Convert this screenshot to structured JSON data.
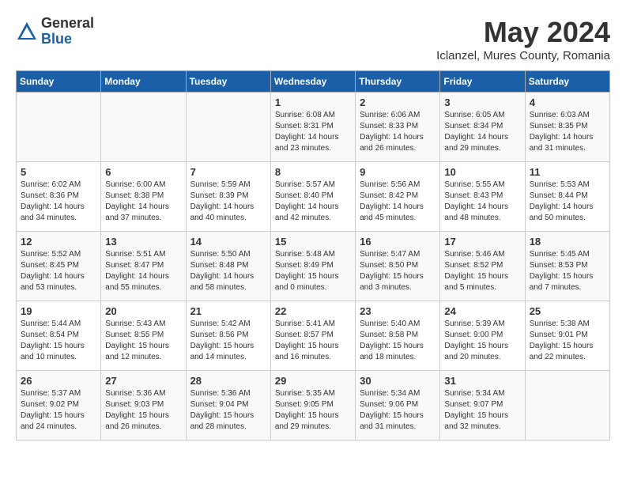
{
  "logo": {
    "general": "General",
    "blue": "Blue"
  },
  "title": {
    "month_year": "May 2024",
    "location": "Iclanzel, Mures County, Romania"
  },
  "headers": [
    "Sunday",
    "Monday",
    "Tuesday",
    "Wednesday",
    "Thursday",
    "Friday",
    "Saturday"
  ],
  "weeks": [
    [
      {
        "day": "",
        "info": ""
      },
      {
        "day": "",
        "info": ""
      },
      {
        "day": "",
        "info": ""
      },
      {
        "day": "1",
        "info": "Sunrise: 6:08 AM\nSunset: 8:31 PM\nDaylight: 14 hours\nand 23 minutes."
      },
      {
        "day": "2",
        "info": "Sunrise: 6:06 AM\nSunset: 8:33 PM\nDaylight: 14 hours\nand 26 minutes."
      },
      {
        "day": "3",
        "info": "Sunrise: 6:05 AM\nSunset: 8:34 PM\nDaylight: 14 hours\nand 29 minutes."
      },
      {
        "day": "4",
        "info": "Sunrise: 6:03 AM\nSunset: 8:35 PM\nDaylight: 14 hours\nand 31 minutes."
      }
    ],
    [
      {
        "day": "5",
        "info": "Sunrise: 6:02 AM\nSunset: 8:36 PM\nDaylight: 14 hours\nand 34 minutes."
      },
      {
        "day": "6",
        "info": "Sunrise: 6:00 AM\nSunset: 8:38 PM\nDaylight: 14 hours\nand 37 minutes."
      },
      {
        "day": "7",
        "info": "Sunrise: 5:59 AM\nSunset: 8:39 PM\nDaylight: 14 hours\nand 40 minutes."
      },
      {
        "day": "8",
        "info": "Sunrise: 5:57 AM\nSunset: 8:40 PM\nDaylight: 14 hours\nand 42 minutes."
      },
      {
        "day": "9",
        "info": "Sunrise: 5:56 AM\nSunset: 8:42 PM\nDaylight: 14 hours\nand 45 minutes."
      },
      {
        "day": "10",
        "info": "Sunrise: 5:55 AM\nSunset: 8:43 PM\nDaylight: 14 hours\nand 48 minutes."
      },
      {
        "day": "11",
        "info": "Sunrise: 5:53 AM\nSunset: 8:44 PM\nDaylight: 14 hours\nand 50 minutes."
      }
    ],
    [
      {
        "day": "12",
        "info": "Sunrise: 5:52 AM\nSunset: 8:45 PM\nDaylight: 14 hours\nand 53 minutes."
      },
      {
        "day": "13",
        "info": "Sunrise: 5:51 AM\nSunset: 8:47 PM\nDaylight: 14 hours\nand 55 minutes."
      },
      {
        "day": "14",
        "info": "Sunrise: 5:50 AM\nSunset: 8:48 PM\nDaylight: 14 hours\nand 58 minutes."
      },
      {
        "day": "15",
        "info": "Sunrise: 5:48 AM\nSunset: 8:49 PM\nDaylight: 15 hours\nand 0 minutes."
      },
      {
        "day": "16",
        "info": "Sunrise: 5:47 AM\nSunset: 8:50 PM\nDaylight: 15 hours\nand 3 minutes."
      },
      {
        "day": "17",
        "info": "Sunrise: 5:46 AM\nSunset: 8:52 PM\nDaylight: 15 hours\nand 5 minutes."
      },
      {
        "day": "18",
        "info": "Sunrise: 5:45 AM\nSunset: 8:53 PM\nDaylight: 15 hours\nand 7 minutes."
      }
    ],
    [
      {
        "day": "19",
        "info": "Sunrise: 5:44 AM\nSunset: 8:54 PM\nDaylight: 15 hours\nand 10 minutes."
      },
      {
        "day": "20",
        "info": "Sunrise: 5:43 AM\nSunset: 8:55 PM\nDaylight: 15 hours\nand 12 minutes."
      },
      {
        "day": "21",
        "info": "Sunrise: 5:42 AM\nSunset: 8:56 PM\nDaylight: 15 hours\nand 14 minutes."
      },
      {
        "day": "22",
        "info": "Sunrise: 5:41 AM\nSunset: 8:57 PM\nDaylight: 15 hours\nand 16 minutes."
      },
      {
        "day": "23",
        "info": "Sunrise: 5:40 AM\nSunset: 8:58 PM\nDaylight: 15 hours\nand 18 minutes."
      },
      {
        "day": "24",
        "info": "Sunrise: 5:39 AM\nSunset: 9:00 PM\nDaylight: 15 hours\nand 20 minutes."
      },
      {
        "day": "25",
        "info": "Sunrise: 5:38 AM\nSunset: 9:01 PM\nDaylight: 15 hours\nand 22 minutes."
      }
    ],
    [
      {
        "day": "26",
        "info": "Sunrise: 5:37 AM\nSunset: 9:02 PM\nDaylight: 15 hours\nand 24 minutes."
      },
      {
        "day": "27",
        "info": "Sunrise: 5:36 AM\nSunset: 9:03 PM\nDaylight: 15 hours\nand 26 minutes."
      },
      {
        "day": "28",
        "info": "Sunrise: 5:36 AM\nSunset: 9:04 PM\nDaylight: 15 hours\nand 28 minutes."
      },
      {
        "day": "29",
        "info": "Sunrise: 5:35 AM\nSunset: 9:05 PM\nDaylight: 15 hours\nand 29 minutes."
      },
      {
        "day": "30",
        "info": "Sunrise: 5:34 AM\nSunset: 9:06 PM\nDaylight: 15 hours\nand 31 minutes."
      },
      {
        "day": "31",
        "info": "Sunrise: 5:34 AM\nSunset: 9:07 PM\nDaylight: 15 hours\nand 32 minutes."
      },
      {
        "day": "",
        "info": ""
      }
    ]
  ]
}
